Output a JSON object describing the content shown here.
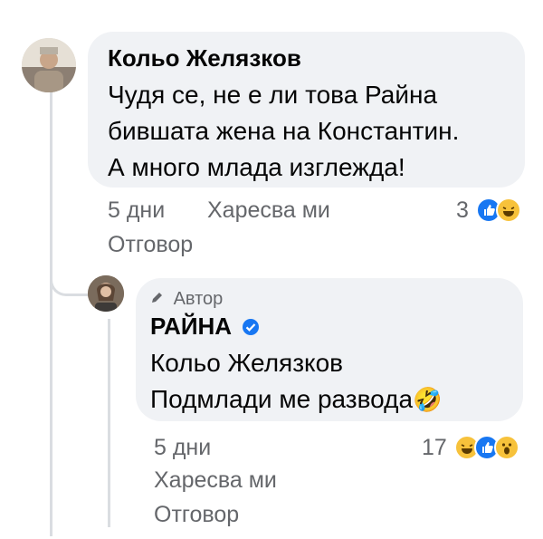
{
  "comment": {
    "author": "Кольо Желязков",
    "lines": [
      "Чудя се, не е ли това Райна",
      "бившата жена на Константин.",
      "А много млада изглежда!"
    ],
    "time": "5 дни",
    "like_label": "Харесва ми",
    "reply_label": "Отговор",
    "reaction_count": "3",
    "reactions": [
      "like-icon",
      "haha-icon"
    ]
  },
  "reply": {
    "badge": "Автор",
    "author": "РАЙНА",
    "verified": true,
    "mention": "Кольо Желязков",
    "text": "Подмлади ме развода",
    "emoji": "🤣",
    "time": "5 дни",
    "like_label": "Харесва ми",
    "reply_label": "Отговор",
    "reaction_count": "17",
    "reactions": [
      "haha-icon",
      "like-icon",
      "wow-icon"
    ]
  },
  "colors": {
    "bubble": "#f0f2f5",
    "meta": "#65676b",
    "like": "#1877f2",
    "haha": "#f7c23b"
  }
}
